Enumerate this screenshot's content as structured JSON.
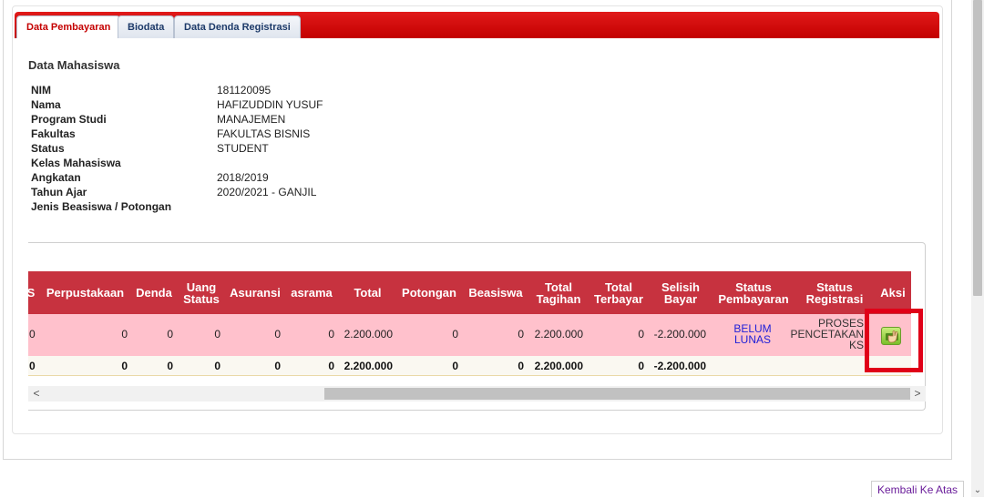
{
  "tabs": [
    {
      "label": "Data Pembayaran",
      "active": true
    },
    {
      "label": "Biodata",
      "active": false
    },
    {
      "label": "Data Denda Registrasi",
      "active": false
    }
  ],
  "section_title": "Data Mahasiswa",
  "student_info": [
    {
      "label": "NIM",
      "value": "181120095"
    },
    {
      "label": "Nama",
      "value": "HAFIZUDDIN YUSUF"
    },
    {
      "label": "Program Studi",
      "value": "MANAJEMEN"
    },
    {
      "label": "Fakultas",
      "value": "FAKULTAS BISNIS"
    },
    {
      "label": "Status",
      "value": "STUDENT"
    },
    {
      "label": "Kelas Mahasiswa",
      "value": ""
    },
    {
      "label": "Angkatan",
      "value": "2018/2019"
    },
    {
      "label": "Tahun Ajar",
      "value": "2020/2021 - GANJIL"
    },
    {
      "label": "Jenis Beasiswa / Potongan",
      "value": ""
    }
  ],
  "table": {
    "headers": {
      "partial": "S",
      "perpustakaan": "Perpustakaan",
      "denda": "Denda",
      "uang_status": "Uang Status",
      "asuransi": "Asuransi",
      "asrama": "asrama",
      "total": "Total",
      "potongan": "Potongan",
      "beasiswa": "Beasiswa",
      "total_tagihan": "Total Tagihan",
      "total_terbayar": "Total Terbayar",
      "selisih_bayar": "Selisih Bayar",
      "status_pembayaran": "Status Pembayaran",
      "status_registrasi": "Status Registrasi",
      "aksi": "Aksi"
    },
    "row": {
      "partial": "0",
      "perpustakaan": "0",
      "denda": "0",
      "uang_status": "0",
      "asuransi": "0",
      "asrama": "0",
      "total": "2.200.000",
      "potongan": "0",
      "beasiswa": "0",
      "total_tagihan": "2.200.000",
      "total_terbayar": "0",
      "selisih_bayar": "-2.200.000",
      "status_pembayaran": "BELUM LUNAS",
      "status_registrasi": "PROSES PENCETAKAN KS"
    },
    "totals": {
      "partial": "0",
      "perpustakaan": "0",
      "denda": "0",
      "uang_status": "0",
      "asuransi": "0",
      "asrama": "0",
      "total": "2.200.000",
      "potongan": "0",
      "beasiswa": "0",
      "total_tagihan": "2.200.000",
      "total_terbayar": "0",
      "selisih_bayar": "-2.200.000"
    },
    "action_icon": "hand-pay-icon"
  },
  "scroll": {
    "left_arrow": "<",
    "right_arrow": ">"
  },
  "back_to_top": "Kembali Ke Atas",
  "colors": {
    "tab_bar": "#c30000",
    "header_row": "#c7323f",
    "data_row": "#ffc1cc",
    "highlight": "#e00018",
    "status_link": "#2020d8"
  }
}
